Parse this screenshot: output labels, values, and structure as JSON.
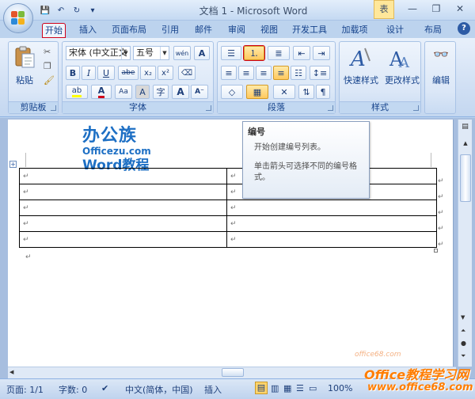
{
  "window": {
    "title": "文档 1 - Microsoft Word",
    "contextual_tab_group": "表",
    "controls": [
      "—",
      "❐",
      "✕"
    ]
  },
  "quick_access": {
    "save": "💾",
    "undo": "↶",
    "redo": "↻",
    "customize": "▾"
  },
  "tabs": [
    "开始",
    "插入",
    "页面布局",
    "引用",
    "邮件",
    "审阅",
    "视图",
    "开发工具",
    "加载项",
    "设计",
    "布局"
  ],
  "ribbon": {
    "clipboard": {
      "label": "剪贴板",
      "paste": "粘贴"
    },
    "font": {
      "label": "字体",
      "font_name": "宋体 (中文正文",
      "font_size": "五号",
      "wen": "wén",
      "bold": "B",
      "italic": "I",
      "underline": "U",
      "strike": "abe",
      "subscript": "x₂",
      "superscript": "x²",
      "grow": "A",
      "shrink": "A",
      "border_char": "A",
      "shade_char": "A",
      "aa": "Aa",
      "char_enclose": "字"
    },
    "paragraph": {
      "label": "段落"
    },
    "styles": {
      "label": "样式",
      "quick_styles": "快速样式",
      "change_styles": "更改样式"
    },
    "editing": {
      "label": "编辑"
    }
  },
  "tooltip": {
    "title": "编号",
    "line1": "开始创建编号列表。",
    "line2": "单击箭头可选择不同的编号格式。"
  },
  "document": {
    "logo_line1": "办公族",
    "logo_line2": "Officezu.com",
    "logo_line3": "Word教程",
    "table_rows": 5,
    "table_cols": 2,
    "cell_mark": "↵"
  },
  "statusbar": {
    "page": "页面: 1/1",
    "words": "字数: 0",
    "language": "中文(简体，中国)",
    "mode": "插入",
    "zoom": "100%"
  },
  "watermark": {
    "brand": "Office教程学习网",
    "url": "www.office68.com",
    "small": "office68.com"
  }
}
